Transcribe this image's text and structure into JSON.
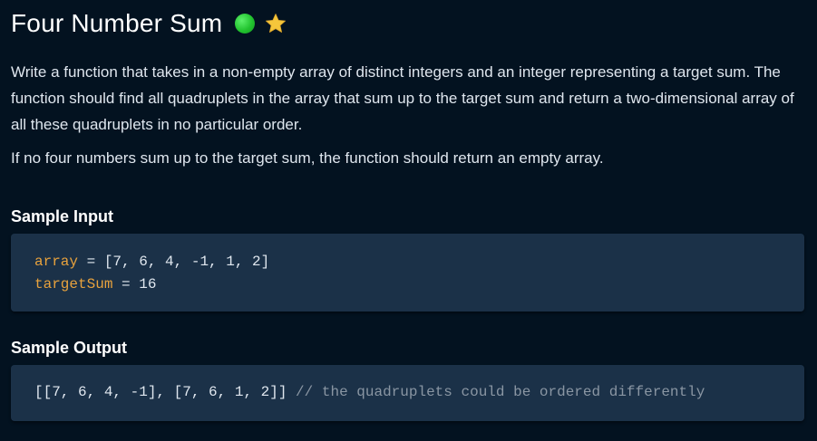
{
  "title": "Four Number Sum",
  "icons": {
    "difficulty": "green-circle-icon",
    "favorite": "star-icon"
  },
  "colors": {
    "background": "#031220",
    "code_background": "#1b3148",
    "variable": "#e8a23d",
    "comment": "#8a96a3",
    "difficulty_green": "#22c32f",
    "star_yellow": "#f5c63b"
  },
  "description": [
    "Write a function that takes in a non-empty array of distinct integers and an integer representing a target sum. The function should find all quadruplets in the array that sum up to the target sum and return a two-dimensional array of all these quadruplets in no particular order.",
    "If no four numbers sum up to the target sum, the function should return an empty array."
  ],
  "sample_input": {
    "heading": "Sample Input",
    "lines": [
      {
        "name": "array",
        "op": " = ",
        "value": "[7, 6, 4, -1, 1, 2]"
      },
      {
        "name": "targetSum",
        "op": " = ",
        "value": "16"
      }
    ]
  },
  "sample_output": {
    "heading": "Sample Output",
    "value": "[[7, 6, 4, -1], [7, 6, 1, 2]]",
    "comment": " // the quadruplets could be ordered differently"
  }
}
